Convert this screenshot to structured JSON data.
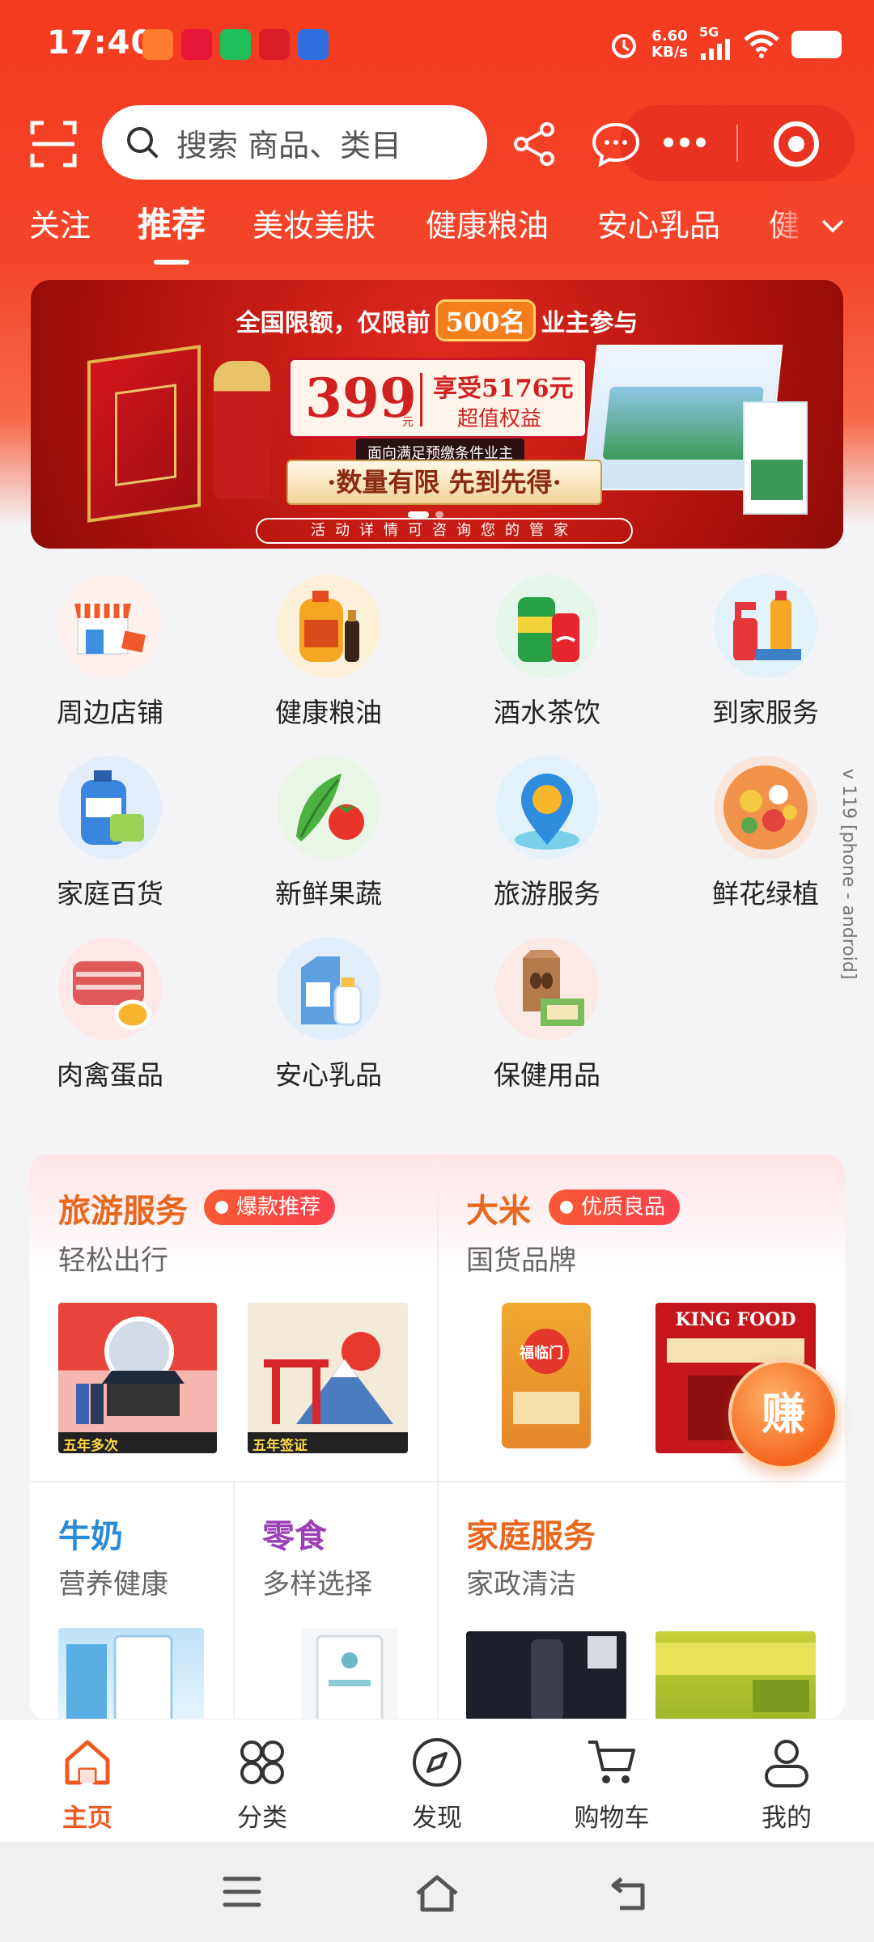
{
  "status_bar": {
    "time": "17:40",
    "net_speed": "6.60",
    "net_unit": "KB/s",
    "signal": "5G",
    "app_icon_colors": [
      "#ff7b2e",
      "#e8173a",
      "#1fbf5c",
      "#d91e2a",
      "#2f6fe0"
    ]
  },
  "search": {
    "placeholder": "搜索 商品、类目"
  },
  "tabs": [
    "关注",
    "推荐",
    "美妆美肤",
    "健康粮油",
    "安心乳品",
    "健"
  ],
  "active_tab": "推荐",
  "banner": {
    "headline_pre": "全国限额，仅限前",
    "headline_badge": "500名",
    "headline_post": "业主参与",
    "price": "399",
    "price_unit": "元",
    "enjoy": "享受5176元",
    "value": "超值权益",
    "condition": "面向满足预缴条件业主",
    "limited": "·数量有限 先到先得·",
    "details": "活动详情可咨询您的管家",
    "slides": 2,
    "active_slide": 0
  },
  "categories": [
    {
      "label": "周边店铺",
      "icon": "storefront-icon"
    },
    {
      "label": "健康粮油",
      "icon": "cooking-oil-icon"
    },
    {
      "label": "酒水茶饮",
      "icon": "beverage-cans-icon"
    },
    {
      "label": "到家服务",
      "icon": "cleaning-supplies-icon"
    },
    {
      "label": "家庭百货",
      "icon": "detergent-icon"
    },
    {
      "label": "新鲜果蔬",
      "icon": "vegetables-icon"
    },
    {
      "label": "旅游服务",
      "icon": "map-pin-icon"
    },
    {
      "label": "鲜花绿植",
      "icon": "flowers-icon"
    },
    {
      "label": "肉禽蛋品",
      "icon": "meat-egg-icon"
    },
    {
      "label": "安心乳品",
      "icon": "milk-icon"
    },
    {
      "label": "保健用品",
      "icon": "health-products-icon"
    }
  ],
  "version_label": "v 119 [phone - android]",
  "cards": {
    "travel": {
      "title": "旅游服务",
      "tag": "爆款推荐",
      "sub": "轻松出行",
      "title_color": "#e8671f",
      "products": [
        "五年多次",
        "五年签证"
      ]
    },
    "rice": {
      "title": "大米",
      "tag": "优质良品",
      "sub": "国货品牌",
      "title_color": "#e8671f",
      "products": [
        "福临门",
        "KING FOOD"
      ]
    },
    "milk": {
      "title": "牛奶",
      "sub": "营养健康",
      "title_color": "#2a8ad8"
    },
    "snack": {
      "title": "零食",
      "sub": "多样选择",
      "title_color": "#9b3fb8"
    },
    "home": {
      "title": "家庭服务",
      "sub": "家政清洁",
      "title_color": "#e8671f"
    }
  },
  "earn_button": "赚",
  "nav": [
    {
      "label": "主页",
      "icon": "home-icon",
      "active": true
    },
    {
      "label": "分类",
      "icon": "category-icon",
      "active": false
    },
    {
      "label": "发现",
      "icon": "compass-icon",
      "active": false
    },
    {
      "label": "购物车",
      "icon": "cart-icon",
      "active": false
    },
    {
      "label": "我的",
      "icon": "profile-icon",
      "active": false
    }
  ],
  "colors": {
    "brand_red": "#f33a1f",
    "accent_orange": "#ef5a23"
  }
}
